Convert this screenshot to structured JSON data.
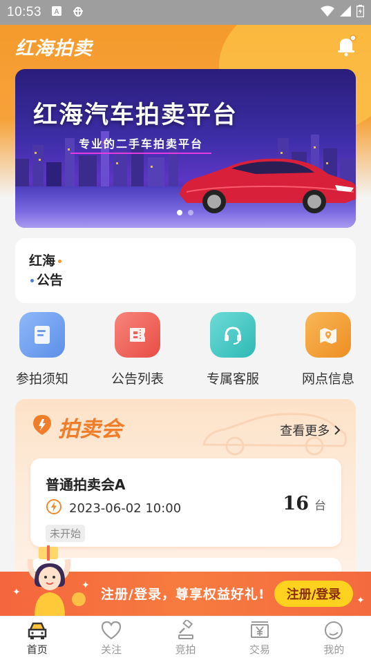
{
  "status_bar": {
    "time": "10:53",
    "icons": [
      "a-icon",
      "bug-icon",
      "wifi-icon",
      "signal-icon",
      "battery-icon"
    ]
  },
  "header": {
    "app_name": "红海拍卖",
    "bell_icon": "bell-icon",
    "accent_color": "#f59a2c"
  },
  "banner": {
    "title": "红海汽车拍卖平台",
    "subtitle": "专业的二手车拍卖平台",
    "slides": 2,
    "active_slide": 1
  },
  "notice": {
    "logo_line1": "红海",
    "logo_line2": "公告"
  },
  "quick_actions": [
    {
      "label": "参拍须知",
      "icon": "book-icon",
      "color": "#6fa0f0"
    },
    {
      "label": "公告列表",
      "icon": "ticket-icon",
      "color": "#f06a5e"
    },
    {
      "label": "专属客服",
      "icon": "headset-icon",
      "color": "#3fc7c4"
    },
    {
      "label": "网点信息",
      "icon": "map-icon",
      "color": "#f5a03a"
    }
  ],
  "auction_section": {
    "title": "拍卖会",
    "view_more": "查看更多",
    "items": [
      {
        "name": "普通拍卖会A",
        "time": "2023-06-02 10:00",
        "count": "16",
        "unit": "台",
        "status": "未开始"
      }
    ]
  },
  "promo": {
    "text": "注册/登录，尊享权益好礼!",
    "button": "注册/登录"
  },
  "bottom_nav": [
    {
      "label": "首页",
      "icon": "car-icon",
      "active": true
    },
    {
      "label": "关注",
      "icon": "heart-icon",
      "active": false
    },
    {
      "label": "竞拍",
      "icon": "gavel-icon",
      "active": false
    },
    {
      "label": "交易",
      "icon": "yen-icon",
      "active": false
    },
    {
      "label": "我的",
      "icon": "profile-icon",
      "active": false
    }
  ]
}
